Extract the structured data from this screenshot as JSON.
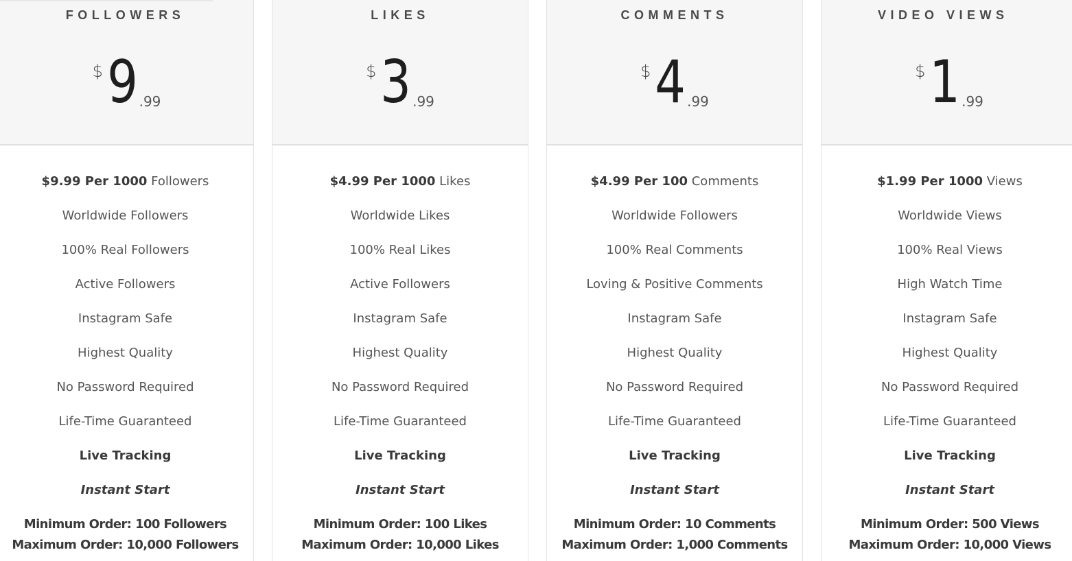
{
  "plans": [
    {
      "title": "Followers",
      "price": {
        "currency": "$",
        "amount": "9",
        "cents": ".99"
      },
      "rate": {
        "bold": "$9.99 Per 1000",
        "unit": "Followers"
      },
      "features": [
        "Worldwide Followers",
        "100% Real Followers",
        "Active Followers",
        "Instagram Safe",
        "Highest Quality",
        "No Password Required",
        "Life-Time Guaranteed"
      ],
      "live_tracking": "Live Tracking",
      "instant_start": "Instant Start",
      "minimum_order": "Minimum Order: 100 Followers",
      "maximum_order": "Maximum Order: 10,000 Followers"
    },
    {
      "title": "Likes",
      "price": {
        "currency": "$",
        "amount": "3",
        "cents": ".99"
      },
      "rate": {
        "bold": "$4.99 Per 1000",
        "unit": "Likes"
      },
      "features": [
        "Worldwide Likes",
        "100% Real Likes",
        "Active Followers",
        "Instagram Safe",
        "Highest Quality",
        "No Password Required",
        "Life-Time Guaranteed"
      ],
      "live_tracking": "Live Tracking",
      "instant_start": "Instant Start",
      "minimum_order": "Minimum Order: 100 Likes",
      "maximum_order": "Maximum Order: 10,000 Likes"
    },
    {
      "title": "Comments",
      "price": {
        "currency": "$",
        "amount": "4",
        "cents": ".99"
      },
      "rate": {
        "bold": "$4.99 Per 100",
        "unit": "Comments"
      },
      "features": [
        "Worldwide Followers",
        "100% Real Comments",
        "Loving & Positive Comments",
        "Instagram Safe",
        "Highest Quality",
        "No Password Required",
        "Life-Time Guaranteed"
      ],
      "live_tracking": "Live Tracking",
      "instant_start": "Instant Start",
      "minimum_order": "Minimum Order: 10 Comments",
      "maximum_order": "Maximum Order: 1,000 Comments"
    },
    {
      "title": "Video Views",
      "price": {
        "currency": "$",
        "amount": "1",
        "cents": ".99"
      },
      "rate": {
        "bold": "$1.99 Per 1000",
        "unit": "Views"
      },
      "features": [
        "Worldwide Views",
        "100% Real Views",
        "High Watch Time",
        "Instagram Safe",
        "Highest Quality",
        "No Password Required",
        "Life-Time Guaranteed"
      ],
      "live_tracking": "Live Tracking",
      "instant_start": "Instant Start",
      "minimum_order": "Minimum Order: 500 Views",
      "maximum_order": "Maximum Order: 10,000 Views"
    }
  ],
  "colors": {
    "header_bg": "#f6f6f6",
    "border": "#e2e2e2",
    "text": "#555555",
    "text_strong": "#3a3a3a",
    "price_text": "#1e1e1e"
  }
}
